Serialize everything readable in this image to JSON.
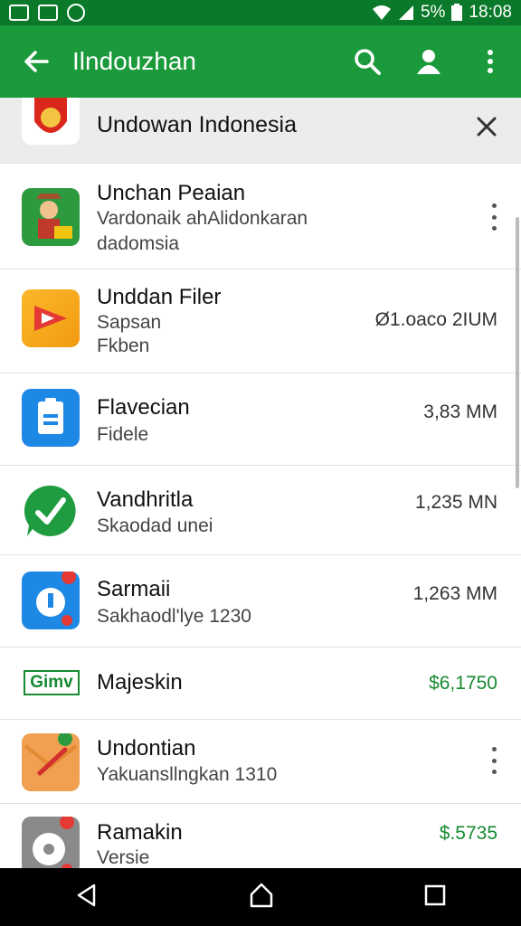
{
  "status_bar": {
    "battery": "5%",
    "time": "18:08"
  },
  "app_bar": {
    "title": "Ilndouzhan"
  },
  "header_item": {
    "title": "Undowan Indonesia"
  },
  "items": [
    {
      "title": "Unchan Peaian",
      "line2": "Vardonaik ahAlidonkaran",
      "line3": "dadomsia",
      "right": ""
    },
    {
      "title": "Unddan Filer",
      "line2": "Sapsan",
      "line3": "Fkben",
      "right": "Ø1.oaco 2IUM"
    },
    {
      "title": "Flavecian",
      "line2": "Fidele",
      "right": "3,83 MM"
    },
    {
      "title": "Vandhritla",
      "line2": "Skaodad unei",
      "right": "1,235 MN"
    },
    {
      "title": "Sarmaii",
      "line2": "Sakhaodl'lye  1230",
      "right": "1,263 MM"
    },
    {
      "title": "Majeskin",
      "badge": "Gimv",
      "right": "$6,1750"
    },
    {
      "title": "Undontian",
      "line2": "Yakuansllngkan  1310",
      "right": ""
    },
    {
      "title": "Ramakin",
      "line2": "Versie",
      "right": "$.5735"
    }
  ],
  "colors": {
    "statusbar": "#0a7a2a",
    "appbar": "#1a9a3a",
    "price_green": "#178a32"
  }
}
